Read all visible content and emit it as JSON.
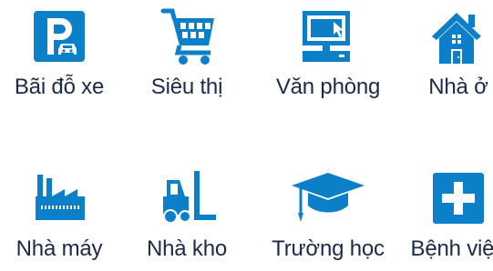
{
  "colors": {
    "icon": "#0b7fc7",
    "text": "#1a2a4a",
    "background": "#ffffff"
  },
  "tiles": [
    {
      "label": "Bãi đỗ xe",
      "icon": "parking-icon"
    },
    {
      "label": "Siêu thị",
      "icon": "shopping-cart-icon"
    },
    {
      "label": "Văn phòng",
      "icon": "computer-icon"
    },
    {
      "label": "Nhà ở",
      "icon": "house-icon"
    },
    {
      "label": "Nhà máy",
      "icon": "factory-icon"
    },
    {
      "label": "Nhà kho",
      "icon": "forklift-icon"
    },
    {
      "label": "Trường học",
      "icon": "graduation-cap-icon"
    },
    {
      "label": "Bệnh viện",
      "icon": "hospital-cross-icon"
    }
  ]
}
